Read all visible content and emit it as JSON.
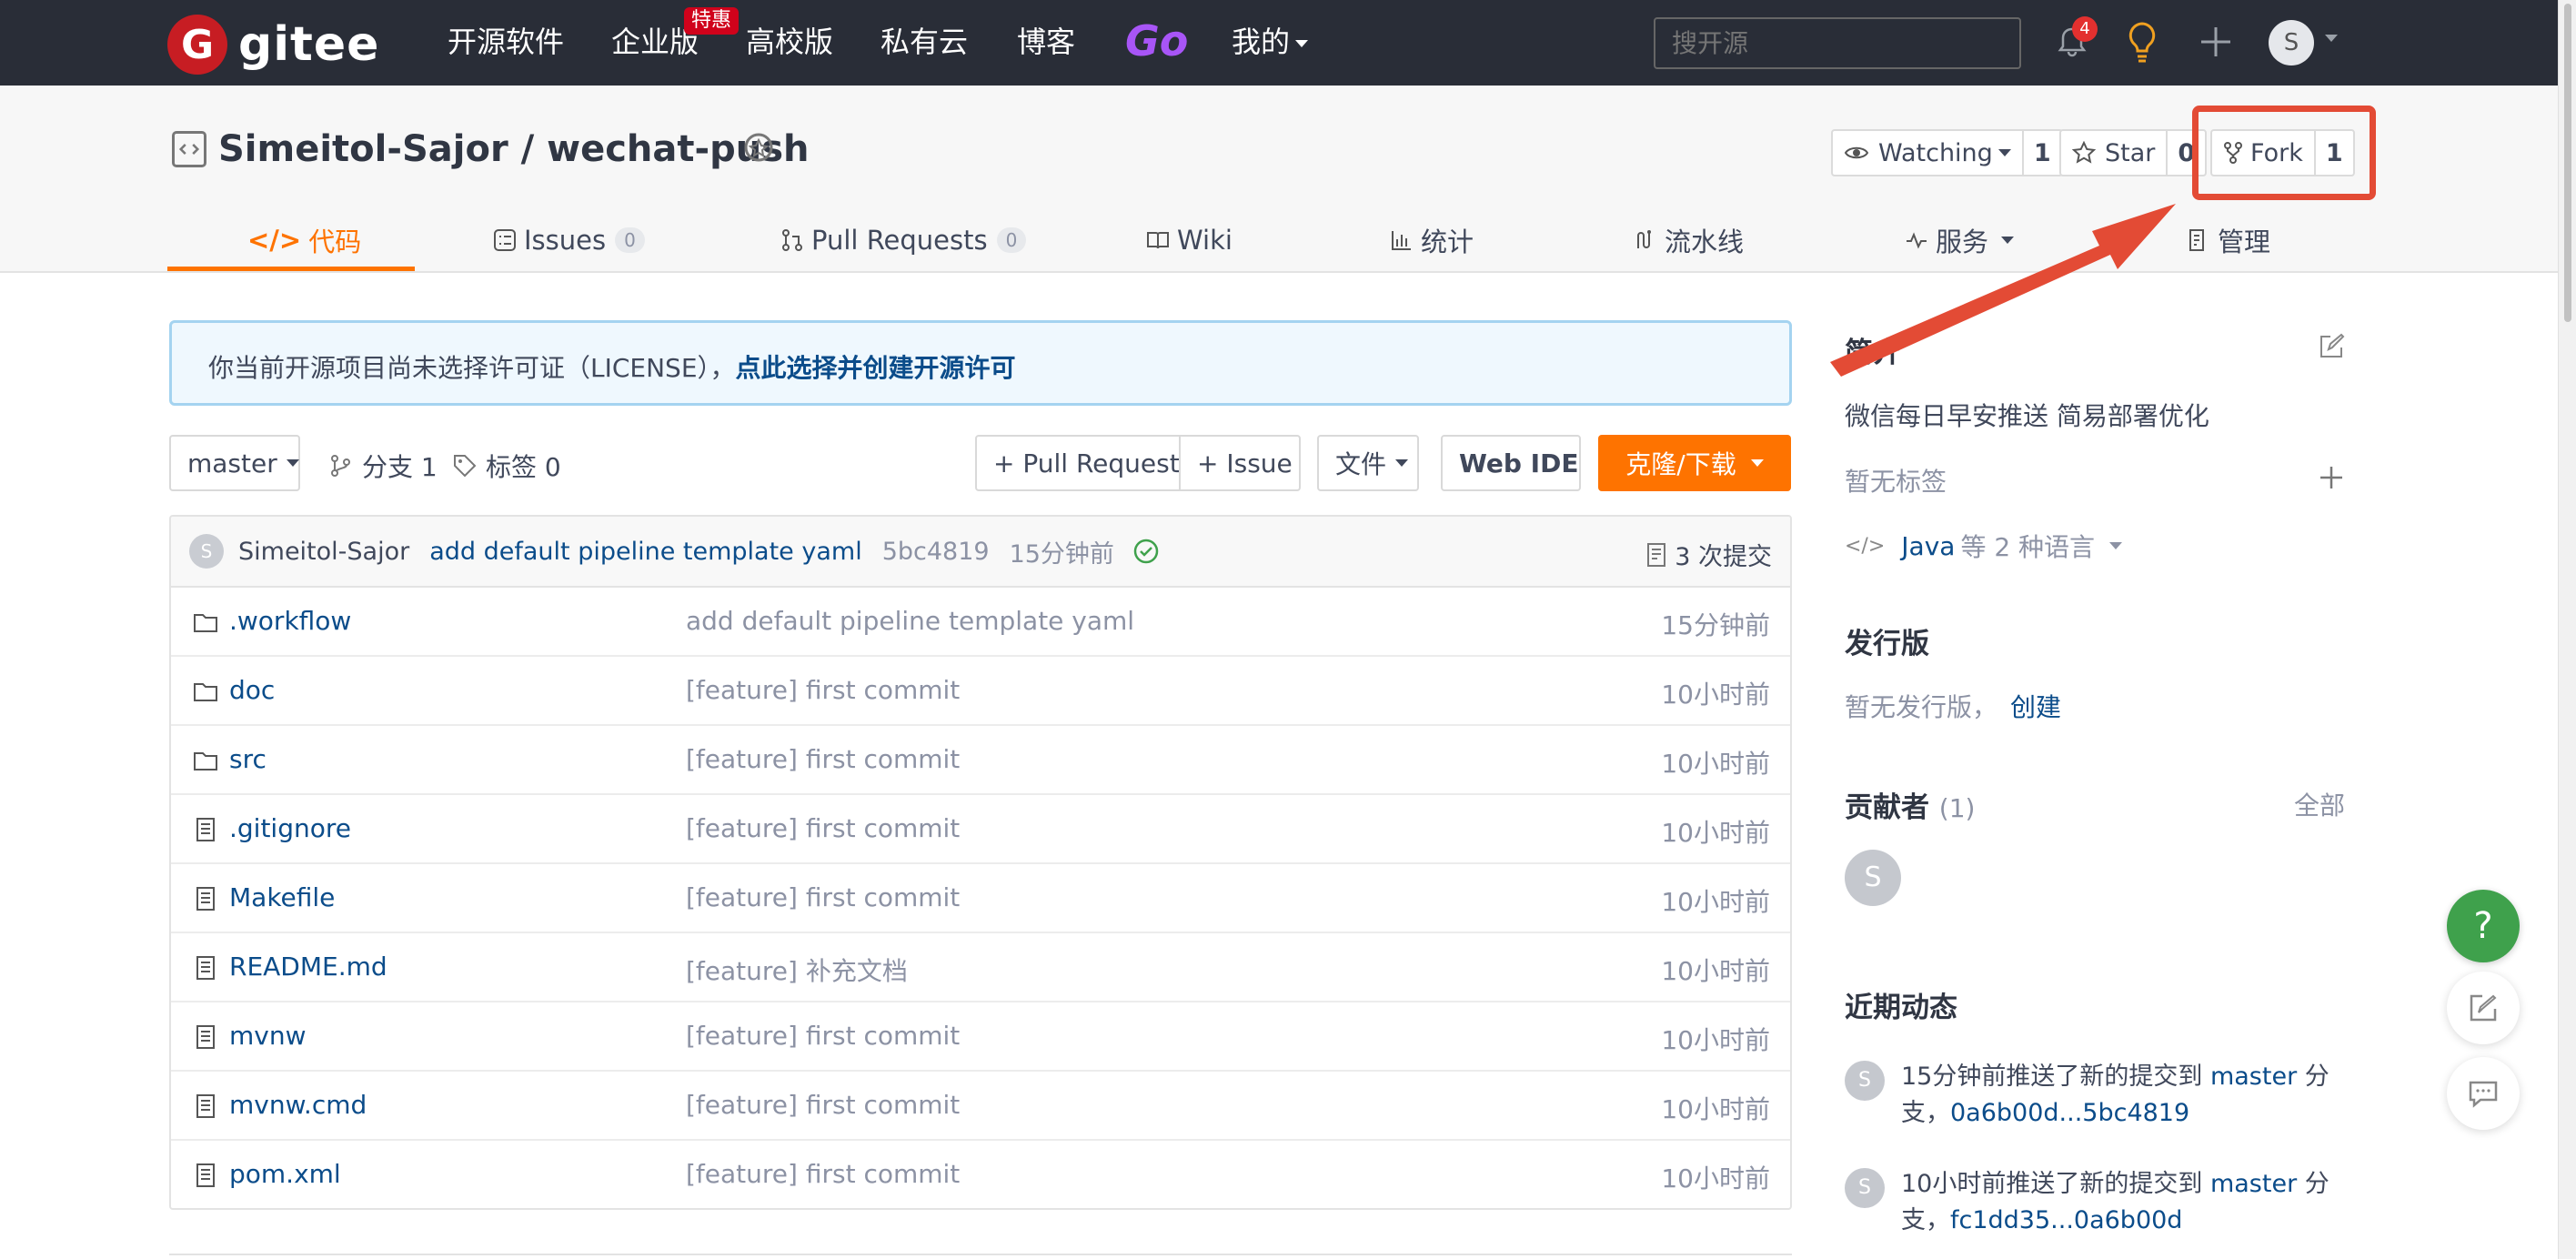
{
  "nav": {
    "logo_letter": "G",
    "logo_text": "gitee",
    "items": [
      "开源软件",
      "企业版",
      "高校版",
      "私有云",
      "博客"
    ],
    "badge": "特惠",
    "go_label": "Go",
    "mine_label": "我的",
    "search_placeholder": "搜开源",
    "notification_count": "4",
    "avatar_letter": "S"
  },
  "repo": {
    "title": "Simeitol-Sajor / wechat-push",
    "watch_label": "Watching",
    "watch_count": "1",
    "star_label": "Star",
    "star_count": "0",
    "fork_label": "Fork",
    "fork_count": "1"
  },
  "tabs": [
    {
      "label": "代码"
    },
    {
      "label": "Issues",
      "count": "0"
    },
    {
      "label": "Pull Requests",
      "count": "0"
    },
    {
      "label": "Wiki"
    },
    {
      "label": "统计"
    },
    {
      "label": "流水线"
    },
    {
      "label": "服务"
    },
    {
      "label": "管理"
    }
  ],
  "notice": {
    "text": "你当前开源项目尚未选择许可证（LICENSE），",
    "link": "点此选择并创建开源许可"
  },
  "toolbar": {
    "branch": "master",
    "branches": "分支 1",
    "tags": "标签 0",
    "pull_request": "+ Pull Request",
    "issue": "+ Issue",
    "file": "文件",
    "webide": "Web IDE",
    "clone": "克隆/下载"
  },
  "commit": {
    "avatar": "S",
    "author": "Simeitol-Sajor",
    "message": "add default pipeline template yaml",
    "sha": "5bc4819",
    "time": "15分钟前",
    "count": "3 次提交"
  },
  "files": [
    {
      "type": "folder",
      "name": ".workflow",
      "message": "add default pipeline template yaml",
      "time": "15分钟前"
    },
    {
      "type": "folder",
      "name": "doc",
      "message": "[feature] first commit",
      "time": "10小时前"
    },
    {
      "type": "folder",
      "name": "src",
      "message": "[feature] first commit",
      "time": "10小时前"
    },
    {
      "type": "file",
      "name": ".gitignore",
      "message": "[feature] first commit",
      "time": "10小时前"
    },
    {
      "type": "file",
      "name": "Makefile",
      "message": "[feature] first commit",
      "time": "10小时前"
    },
    {
      "type": "file",
      "name": "README.md",
      "message": "[feature] 补充文档",
      "time": "10小时前"
    },
    {
      "type": "file",
      "name": "mvnw",
      "message": "[feature] first commit",
      "time": "10小时前"
    },
    {
      "type": "file",
      "name": "mvnw.cmd",
      "message": "[feature] first commit",
      "time": "10小时前"
    },
    {
      "type": "file",
      "name": "pom.xml",
      "message": "[feature] first commit",
      "time": "10小时前"
    }
  ],
  "sidebar": {
    "intro_title": "简介",
    "intro_text": "微信每日早安推送 简易部署优化",
    "no_tags": "暂无标签",
    "lang_main": "Java",
    "lang_rest": "等 2 种语言",
    "release_title": "发行版",
    "no_release": "暂无发行版，",
    "create": "创建",
    "contrib_title": "贡献者",
    "contrib_count": "(1)",
    "all": "全部",
    "contrib_avatar": "S",
    "activity_title": "近期动态",
    "activities": [
      {
        "avatar": "S",
        "text": "15分钟前推送了新的提交到",
        "branch": "master",
        "suffix": "分支，",
        "range": "0a6b00d...5bc4819"
      },
      {
        "avatar": "S",
        "text": "10小时前推送了新的提交到",
        "branch": "master",
        "suffix": "分支，",
        "range": "fc1dd35...0a6b00d"
      }
    ]
  },
  "floating": {
    "help": "?"
  },
  "colors": {
    "accent": "#fe7300",
    "nav_bg": "#292d37",
    "link": "#0b4c8a",
    "highlight": "#e34b35",
    "help": "#3fa14c"
  }
}
